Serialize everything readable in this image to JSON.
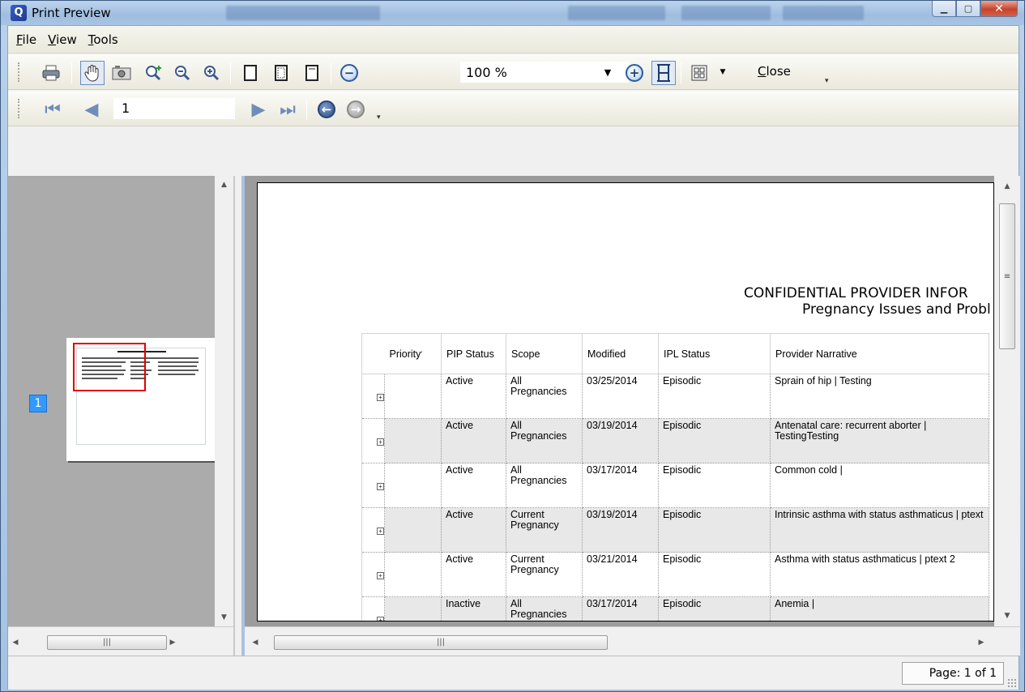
{
  "window": {
    "title": "Print Preview",
    "app_icon_letter": "Q"
  },
  "menu": [
    {
      "accel": "F",
      "rest": "ile"
    },
    {
      "accel": "V",
      "rest": "iew"
    },
    {
      "accel": "T",
      "rest": "ools"
    }
  ],
  "toolbar": {
    "zoom_value": "100 %",
    "close_accel": "C",
    "close_rest": "lose"
  },
  "navigation": {
    "current_page": "1"
  },
  "thumbnails": {
    "page_badge": "1"
  },
  "report": {
    "heading_line1": "CONFIDENTIAL PROVIDER INFOR",
    "heading_line2": "Pregnancy Issues and Probl",
    "columns": [
      "Priority",
      "PIP Status",
      "Scope",
      "Modified",
      "IPL Status",
      "Provider Narrative"
    ],
    "rows": [
      {
        "priority": "",
        "pip_status": "Active",
        "scope": "All Pregnancies",
        "modified": "03/25/2014",
        "ipl_status": "Episodic",
        "narrative": "Sprain of hip | Testing"
      },
      {
        "priority": "",
        "pip_status": "Active",
        "scope": "All Pregnancies",
        "modified": "03/19/2014",
        "ipl_status": "Episodic",
        "narrative": "Antenatal care: recurrent aborter | TestingTesting"
      },
      {
        "priority": "",
        "pip_status": "Active",
        "scope": "All Pregnancies",
        "modified": "03/17/2014",
        "ipl_status": "Episodic",
        "narrative": "Common cold |"
      },
      {
        "priority": "",
        "pip_status": "Active",
        "scope": "Current Pregnancy",
        "modified": "03/19/2014",
        "ipl_status": "Episodic",
        "narrative": "Intrinsic asthma with status asthmaticus | ptext"
      },
      {
        "priority": "",
        "pip_status": "Active",
        "scope": "Current Pregnancy",
        "modified": "03/21/2014",
        "ipl_status": "Episodic",
        "narrative": "Asthma with status asthmaticus | ptext 2"
      },
      {
        "priority": "",
        "pip_status": "Inactive",
        "scope": "All Pregnancies",
        "modified": "03/17/2014",
        "ipl_status": "Episodic",
        "narrative": "Anemia |"
      }
    ]
  },
  "status": {
    "page_info": "Page: 1 of 1"
  },
  "colors": {
    "accent": "#3399ff",
    "thumbnail_highlight": "#e00000",
    "row_alt": "#e8e8e8"
  }
}
